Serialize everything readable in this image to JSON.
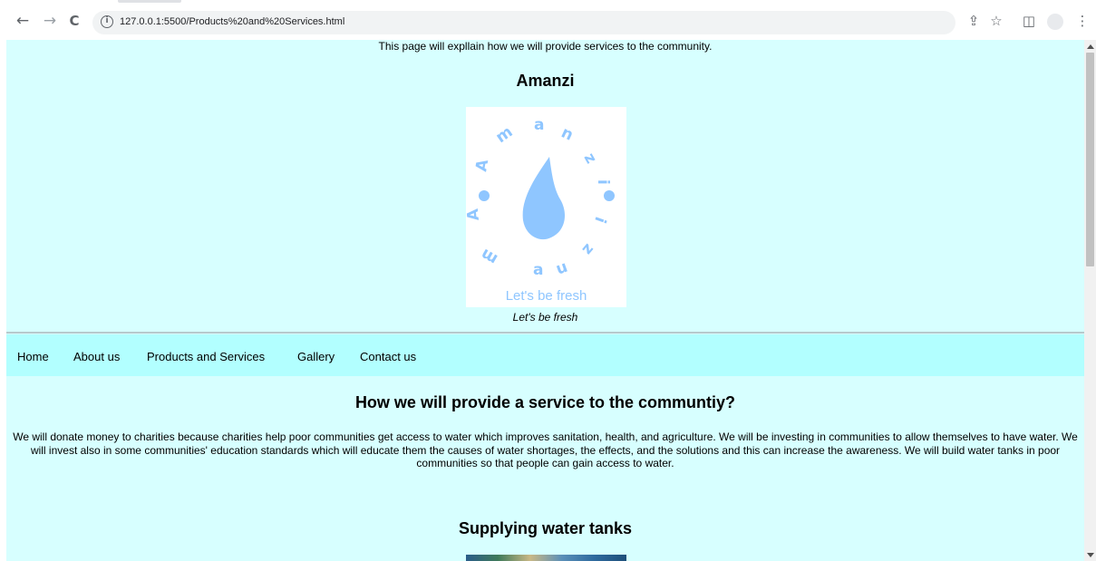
{
  "browser": {
    "url": "127.0.0.1:5500/Products%20and%20Services.html",
    "back_icon": "←",
    "forward_icon": "→",
    "reload_icon": "C",
    "info_icon": "i",
    "share_icon": "⇪",
    "star_icon": "☆",
    "sidepanel_icon": "◫",
    "menu_icon": "⋮"
  },
  "page": {
    "intro": "This page will expllain how we will provide services to the community.",
    "brand": "Amanzi",
    "logo": {
      "ring_text": "Amanzi",
      "tagline": "Let's be fresh",
      "color": "#8fc6ff"
    },
    "caption": "Let's be fresh",
    "nav": [
      "Home",
      "About us",
      "Products and Services",
      "Gallery",
      "Contact us"
    ],
    "service_heading": "How we will provide a service to the communtiy?",
    "service_text": "We will donate money to charities because charities help poor communities get access to water which improves sanitation, health, and agriculture. We will be investing in communities to allow themselves to have water. We will invest also in some communities' education standards which will educate them the causes of water shortages, the effects, and the solutions and this can increase the awareness. We will build water tanks in poor communities so that people can gain access to water.",
    "tanks_heading": "Supplying water tanks"
  },
  "colors": {
    "page_bg": "#d7ffff",
    "nav_bg": "#b2ffff"
  }
}
